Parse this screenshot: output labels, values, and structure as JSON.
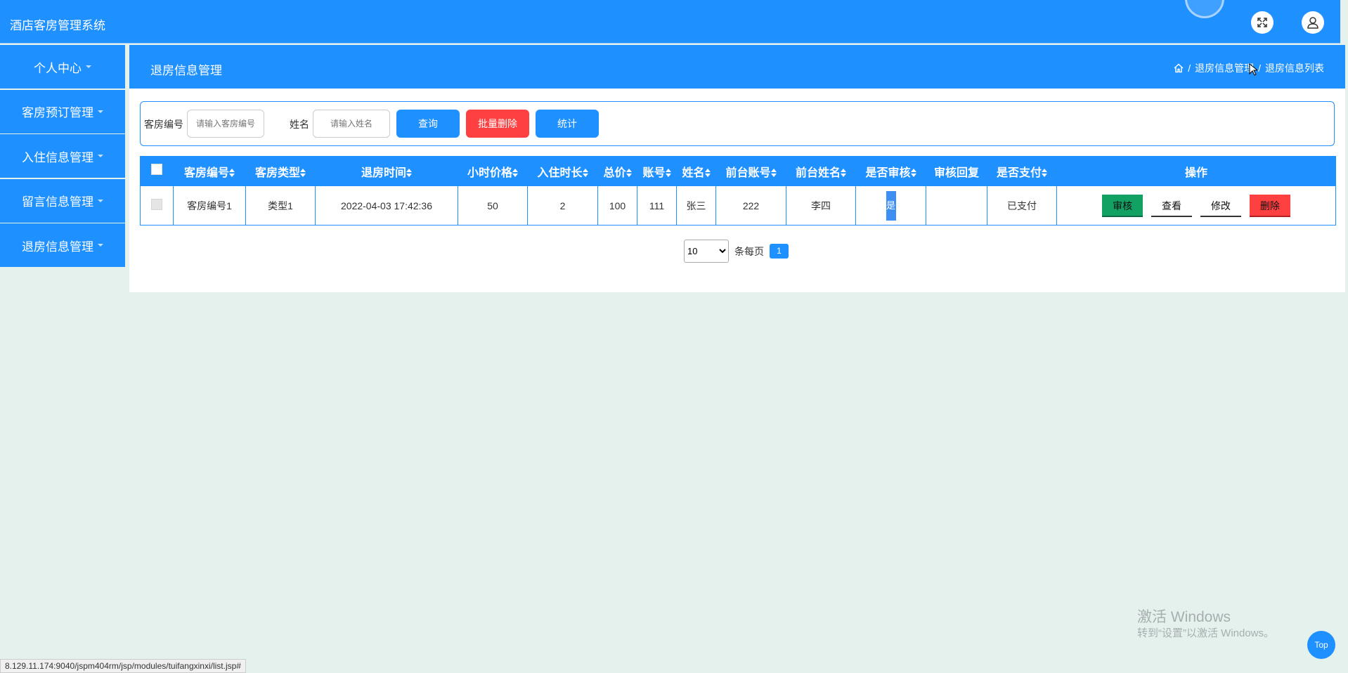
{
  "app": {
    "title": "酒店客房管理系统"
  },
  "topbar": {
    "icons": [
      "fullscreen-icon",
      "user-icon"
    ]
  },
  "sidebar": {
    "items": [
      {
        "label": "个人中心"
      },
      {
        "label": "客房预订管理"
      },
      {
        "label": "入住信息管理"
      },
      {
        "label": "留言信息管理"
      },
      {
        "label": "退房信息管理"
      }
    ]
  },
  "page": {
    "title": "退房信息管理",
    "breadcrumb": [
      "退房信息管理",
      "退房信息列表"
    ],
    "separator": "/"
  },
  "search": {
    "room_label": "客房编号",
    "room_placeholder": "请输入客房编号",
    "name_label": "姓名",
    "name_placeholder": "请输入姓名",
    "query_btn": "查询",
    "batch_delete_btn": "批量删除",
    "stats_btn": "统计"
  },
  "table": {
    "headers": [
      "客房编号",
      "客房类型",
      "退房时间",
      "小时价格",
      "入住时长",
      "总价",
      "账号",
      "姓名",
      "前台账号",
      "前台姓名",
      "是否审核",
      "审核回复",
      "是否支付",
      "操作"
    ],
    "rows": [
      {
        "room_no": "客房编号1",
        "room_type": "类型1",
        "checkout_time": "2022-04-03 17:42:36",
        "hour_price": "50",
        "duration": "2",
        "total": "100",
        "account": "111",
        "name": "张三",
        "desk_account": "222",
        "desk_name": "李四",
        "reviewed": "是",
        "review_reply": "",
        "paid": "已支付"
      }
    ],
    "actions": [
      "审核",
      "查看",
      "修改",
      "删除"
    ]
  },
  "pagination": {
    "page_size": "10",
    "per_page_label": "条每页",
    "current_page": "1"
  },
  "colors": {
    "primary": "#1e90ff",
    "danger": "#ff4040",
    "success": "#13a063",
    "background": "#e4f1ec"
  },
  "watermark": {
    "line1": "激活 Windows",
    "line2": "转到“设置”以激活 Windows。"
  },
  "top_button": "Top",
  "status_bar": {
    "url": "8.129.11.174:9040/jspm404rm/jsp/modules/tuifangxinxi/list.jsp#"
  }
}
